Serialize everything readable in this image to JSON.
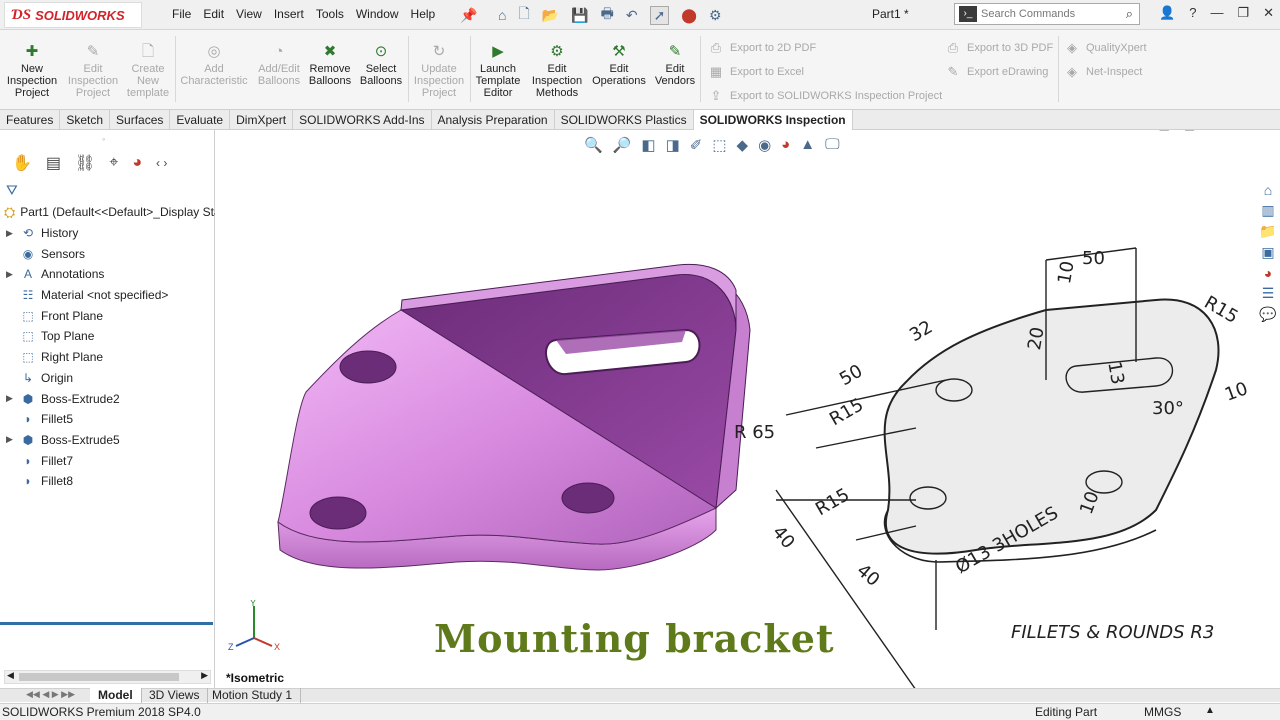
{
  "app": {
    "brand": "SOLIDWORKS",
    "document_title": "Part1 *"
  },
  "menu": [
    "File",
    "Edit",
    "View",
    "Insert",
    "Tools",
    "Window",
    "Help"
  ],
  "search": {
    "placeholder": "Search Commands"
  },
  "inspection_buttons": [
    {
      "label": "New Inspection Project",
      "lines": [
        "New",
        "Inspection",
        "Project"
      ],
      "enabled": true
    },
    {
      "label": "Edit Inspection Project",
      "lines": [
        "Edit",
        "Inspection",
        "Project"
      ],
      "enabled": false
    },
    {
      "label": "Create New template",
      "lines": [
        "Create",
        "New",
        "template"
      ],
      "enabled": false
    },
    {
      "label": "Add Characteristic",
      "lines": [
        "Add",
        "Characteristic"
      ],
      "enabled": false
    },
    {
      "label": "Add/Edit Balloons",
      "lines": [
        "Add/Edit",
        "Balloons"
      ],
      "enabled": false
    },
    {
      "label": "Remove Balloons",
      "lines": [
        "Remove",
        "Balloons"
      ],
      "enabled": true
    },
    {
      "label": "Select Balloons",
      "lines": [
        "Select",
        "Balloons"
      ],
      "enabled": true
    },
    {
      "label": "Update Inspection Project",
      "lines": [
        "Update",
        "Inspection",
        "Project"
      ],
      "enabled": false
    },
    {
      "label": "Launch Template Editor",
      "lines": [
        "Launch",
        "Template",
        "Editor"
      ],
      "enabled": true
    },
    {
      "label": "Edit Inspection Methods",
      "lines": [
        "Edit",
        "Inspection",
        "Methods"
      ],
      "enabled": true
    },
    {
      "label": "Edit Operations",
      "lines": [
        "Edit",
        "Operations"
      ],
      "enabled": true
    },
    {
      "label": "Edit Vendors",
      "lines": [
        "Edit",
        "Vendors"
      ],
      "enabled": true
    }
  ],
  "export_buttons": {
    "to_2d_pdf": "Export to 2D PDF",
    "to_excel": "Export to Excel",
    "to_inspection_project": "Export to SOLIDWORKS Inspection Project",
    "to_3d_pdf": "Export to 3D PDF",
    "edrawing": "Export eDrawing",
    "qualityxpert": "QualityXpert",
    "net_inspect": "Net-Inspect"
  },
  "tabs": [
    "Features",
    "Sketch",
    "Surfaces",
    "Evaluate",
    "DimXpert",
    "SOLIDWORKS Add-Ins",
    "Analysis Preparation",
    "SOLIDWORKS Plastics",
    "SOLIDWORKS Inspection"
  ],
  "active_tab": "SOLIDWORKS Inspection",
  "tree": {
    "root": "Part1  (Default<<Default>_Display Sta",
    "items": [
      {
        "label": "History",
        "expandable": true,
        "icon": "history-icon"
      },
      {
        "label": "Sensors",
        "expandable": false,
        "icon": "sensors-icon"
      },
      {
        "label": "Annotations",
        "expandable": true,
        "icon": "annotations-icon"
      },
      {
        "label": "Material <not specified>",
        "expandable": false,
        "icon": "material-icon"
      },
      {
        "label": "Front Plane",
        "expandable": false,
        "icon": "plane-icon"
      },
      {
        "label": "Top Plane",
        "expandable": false,
        "icon": "plane-icon"
      },
      {
        "label": "Right Plane",
        "expandable": false,
        "icon": "plane-icon"
      },
      {
        "label": "Origin",
        "expandable": false,
        "icon": "origin-icon"
      },
      {
        "label": "Boss-Extrude2",
        "expandable": true,
        "icon": "extrude-icon"
      },
      {
        "label": "Fillet5",
        "expandable": false,
        "icon": "fillet-icon"
      },
      {
        "label": "Boss-Extrude5",
        "expandable": true,
        "icon": "extrude-icon"
      },
      {
        "label": "Fillet7",
        "expandable": false,
        "icon": "fillet-icon"
      },
      {
        "label": "Fillet8",
        "expandable": false,
        "icon": "fillet-icon"
      }
    ]
  },
  "viewport": {
    "view_label": "*Isometric",
    "overlay_title": "Mounting bracket",
    "model_color": "#d98ce0",
    "drawing_dims": [
      "50",
      "10",
      "R15",
      "32",
      "50",
      "20",
      "13",
      "30°",
      "10",
      "R 65",
      "R15",
      "R15",
      "40",
      "10",
      "40",
      "Ø13 3HOLES"
    ],
    "drawing_note": "FILLETS & ROUNDS R3"
  },
  "bottom_tabs": [
    "Model",
    "3D Views",
    "Motion Study 1"
  ],
  "active_bottom_tab": "Model",
  "status": {
    "version": "SOLIDWORKS Premium 2018 SP4.0",
    "mode": "Editing Part",
    "units": "MMGS"
  },
  "colors": {
    "brand_red": "#d2232a",
    "title_green": "#5e7a1a",
    "selection_blue": "#2f6fa6"
  }
}
